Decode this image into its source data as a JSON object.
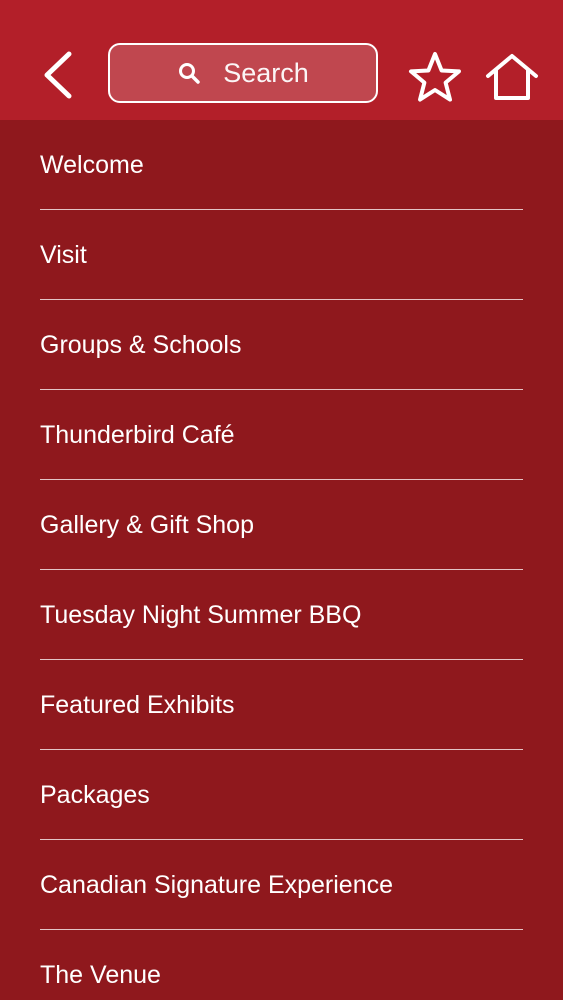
{
  "header": {
    "search_placeholder": "Search",
    "icons": {
      "back": "chevron-left-icon",
      "search": "magnifier-icon",
      "favorite": "star-outline-icon",
      "home": "home-outline-icon"
    },
    "colors": {
      "topbar": "#b31f29",
      "background": "#8f181d",
      "foreground": "#ffffff"
    }
  },
  "menu": {
    "items": [
      {
        "label": "Welcome"
      },
      {
        "label": "Visit"
      },
      {
        "label": "Groups & Schools"
      },
      {
        "label": "Thunderbird Café"
      },
      {
        "label": "Gallery & Gift Shop"
      },
      {
        "label": "Tuesday Night Summer BBQ"
      },
      {
        "label": "Featured Exhibits"
      },
      {
        "label": "Packages"
      },
      {
        "label": "Canadian Signature Experience"
      },
      {
        "label": "The Venue"
      }
    ]
  }
}
